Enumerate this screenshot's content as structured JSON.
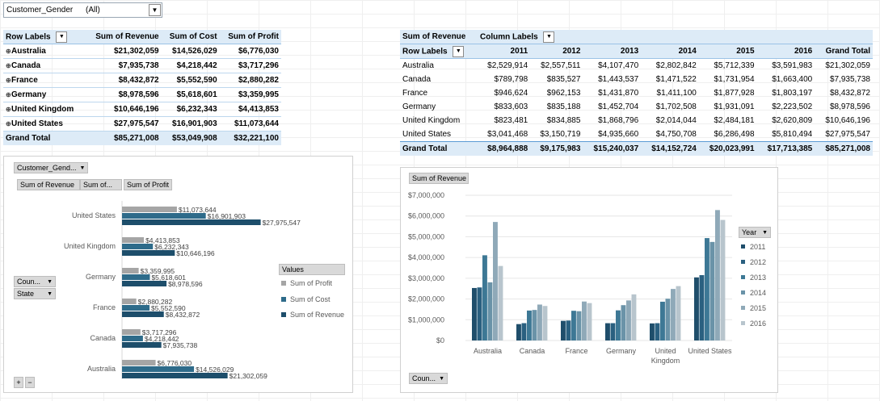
{
  "filter": {
    "label": "Customer_Gender",
    "value": "(All)"
  },
  "left_pivot": {
    "headers": [
      "Row Labels",
      "Sum of Revenue",
      "Sum of Cost",
      "Sum of Profit"
    ],
    "rows": [
      {
        "label": "Australia",
        "revenue": "$21,302,059",
        "cost": "$14,526,029",
        "profit": "$6,776,030"
      },
      {
        "label": "Canada",
        "revenue": "$7,935,738",
        "cost": "$4,218,442",
        "profit": "$3,717,296"
      },
      {
        "label": "France",
        "revenue": "$8,432,872",
        "cost": "$5,552,590",
        "profit": "$2,880,282"
      },
      {
        "label": "Germany",
        "revenue": "$8,978,596",
        "cost": "$5,618,601",
        "profit": "$3,359,995"
      },
      {
        "label": "United Kingdom",
        "revenue": "$10,646,196",
        "cost": "$6,232,343",
        "profit": "$4,413,853"
      },
      {
        "label": "United States",
        "revenue": "$27,975,547",
        "cost": "$16,901,903",
        "profit": "$11,073,644"
      }
    ],
    "total": {
      "label": "Grand Total",
      "revenue": "$85,271,008",
      "cost": "$53,049,908",
      "profit": "$32,221,100"
    }
  },
  "right_pivot": {
    "corner": "Sum of Revenue",
    "col_labels": "Column Labels",
    "row_labels": "Row Labels",
    "years": [
      "2011",
      "2012",
      "2013",
      "2014",
      "2015",
      "2016",
      "Grand Total"
    ],
    "rows": [
      {
        "label": "Australia",
        "vals": [
          "$2,529,914",
          "$2,557,511",
          "$4,107,470",
          "$2,802,842",
          "$5,712,339",
          "$3,591,983",
          "$21,302,059"
        ]
      },
      {
        "label": "Canada",
        "vals": [
          "$789,798",
          "$835,527",
          "$1,443,537",
          "$1,471,522",
          "$1,731,954",
          "$1,663,400",
          "$7,935,738"
        ]
      },
      {
        "label": "France",
        "vals": [
          "$946,624",
          "$962,153",
          "$1,431,870",
          "$1,411,100",
          "$1,877,928",
          "$1,803,197",
          "$8,432,872"
        ]
      },
      {
        "label": "Germany",
        "vals": [
          "$833,603",
          "$835,188",
          "$1,452,704",
          "$1,702,508",
          "$1,931,091",
          "$2,223,502",
          "$8,978,596"
        ]
      },
      {
        "label": "United Kingdom",
        "vals": [
          "$823,481",
          "$834,885",
          "$1,868,796",
          "$2,014,044",
          "$2,484,181",
          "$2,620,809",
          "$10,646,196"
        ]
      },
      {
        "label": "United States",
        "vals": [
          "$3,041,468",
          "$3,150,719",
          "$4,935,660",
          "$4,750,708",
          "$6,286,498",
          "$5,810,494",
          "$27,975,547"
        ]
      }
    ],
    "total": {
      "label": "Grand Total",
      "vals": [
        "$8,964,888",
        "$9,175,983",
        "$15,240,037",
        "$14,152,724",
        "$20,023,991",
        "$17,713,385",
        "$85,271,008"
      ]
    }
  },
  "left_chart_ui": {
    "filter_btn": "Customer_Gend...",
    "value_btns": [
      "Sum of Revenue",
      "Sum of...",
      "Sum of Profit"
    ],
    "axis_btns": [
      "Coun...",
      "State"
    ],
    "legend_title": "Values",
    "zoom": [
      "+",
      "−"
    ]
  },
  "right_chart_ui": {
    "value_btn": "Sum of Revenue",
    "legend_title": "Year",
    "axis_btn": "Coun..."
  },
  "colors": {
    "profit": "#a5a5a5",
    "cost": "#2e6b8a",
    "revenue": "#1d4e6b",
    "y2011": "#1f4e6b",
    "y2012": "#2a6080",
    "y2013": "#3d7895",
    "y2014": "#6a93a8",
    "y2015": "#8fa9b8",
    "y2016": "#b8c5cd"
  },
  "chart_data": [
    {
      "type": "bar",
      "orientation": "horizontal",
      "categories": [
        "United States",
        "United Kingdom",
        "Germany",
        "France",
        "Canada",
        "Australia"
      ],
      "series": [
        {
          "name": "Sum of Profit",
          "values": [
            11073644,
            4413853,
            3359995,
            2880282,
            3717296,
            6776030
          ],
          "labels": [
            "$11,073,644",
            "$4,413,853",
            "$3,359,995",
            "$2,880,282",
            "$3,717,296",
            "$6,776,030"
          ]
        },
        {
          "name": "Sum of Cost",
          "values": [
            16901903,
            6232343,
            5618601,
            5552590,
            4218442,
            14526029
          ],
          "labels": [
            "$16,901,903",
            "$6,232,343",
            "$5,618,601",
            "$5,552,590",
            "$4,218,442",
            "$14,526,029"
          ]
        },
        {
          "name": "Sum of Revenue",
          "values": [
            27975547,
            10646196,
            8978596,
            8432872,
            7935738,
            21302059
          ],
          "labels": [
            "$27,975,547",
            "$10,646,196",
            "$8,978,596",
            "$8,432,872",
            "$7,935,738",
            "$21,302,059"
          ]
        }
      ],
      "xlim": [
        0,
        30000000
      ]
    },
    {
      "type": "bar",
      "categories": [
        "Australia",
        "Canada",
        "France",
        "Germany",
        "United Kingdom",
        "United States"
      ],
      "series": [
        {
          "name": "2011",
          "values": [
            2529914,
            789798,
            946624,
            833603,
            823481,
            3041468
          ]
        },
        {
          "name": "2012",
          "values": [
            2557511,
            835527,
            962153,
            835188,
            834885,
            3150719
          ]
        },
        {
          "name": "2013",
          "values": [
            4107470,
            1443537,
            1431870,
            1452704,
            1868796,
            4935660
          ]
        },
        {
          "name": "2014",
          "values": [
            2802842,
            1471522,
            1411100,
            1702508,
            2014044,
            4750708
          ]
        },
        {
          "name": "2015",
          "values": [
            5712339,
            1731954,
            1877928,
            1931091,
            2484181,
            6286498
          ]
        },
        {
          "name": "2016",
          "values": [
            3591983,
            1663400,
            1803197,
            2223502,
            2620809,
            5810494
          ]
        }
      ],
      "ylim": [
        0,
        7000000
      ],
      "yticks": [
        "$0",
        "$1,000,000",
        "$2,000,000",
        "$3,000,000",
        "$4,000,000",
        "$5,000,000",
        "$6,000,000",
        "$7,000,000"
      ],
      "ytick_values": [
        0,
        1000000,
        2000000,
        3000000,
        4000000,
        5000000,
        6000000,
        7000000
      ],
      "legend_title": "Year",
      "legend": "right"
    }
  ]
}
